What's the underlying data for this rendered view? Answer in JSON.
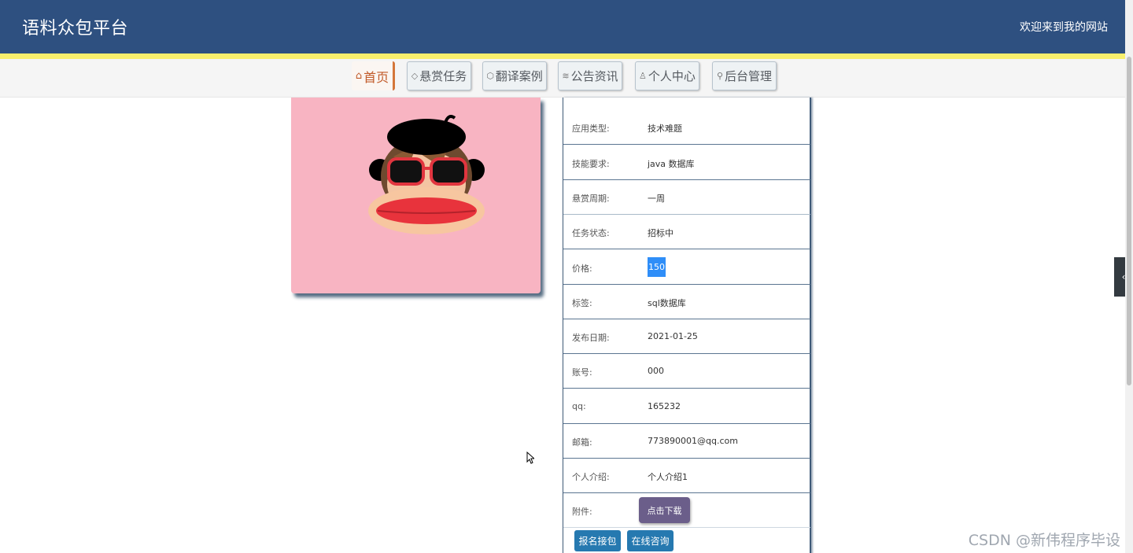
{
  "header": {
    "logo": "语料众包平台",
    "welcome": "欢迎来到我的网站"
  },
  "nav": [
    {
      "label": "首页",
      "icon": "home-icon",
      "glyph": "⌂",
      "active": true
    },
    {
      "label": "悬赏任务",
      "icon": "tag-icon",
      "glyph": "◇",
      "active": false
    },
    {
      "label": "翻译案例",
      "icon": "box-icon",
      "glyph": "⬡",
      "active": false
    },
    {
      "label": "公告资讯",
      "icon": "layers-icon",
      "glyph": "≋",
      "active": false
    },
    {
      "label": "个人中心",
      "icon": "user-icon",
      "glyph": "♙",
      "active": false
    },
    {
      "label": "后台管理",
      "icon": "link-icon",
      "glyph": "⚲",
      "active": false
    }
  ],
  "details": [
    {
      "label": "应用类型:",
      "value": "技术难题"
    },
    {
      "label": "技能要求:",
      "value": "java 数据库"
    },
    {
      "label": "悬赏周期:",
      "value": "一周"
    },
    {
      "label": "任务状态:",
      "value": "招标中"
    },
    {
      "label": "价格:",
      "value": "150"
    },
    {
      "label": "标签:",
      "value": "sql数据库"
    },
    {
      "label": "发布日期:",
      "value": "2021-01-25"
    },
    {
      "label": "账号:",
      "value": "000"
    },
    {
      "label": "qq:",
      "value": "165232"
    },
    {
      "label": "邮箱:",
      "value": "773890001@qq.com"
    },
    {
      "label": "个人介绍:",
      "value": "个人介绍1"
    }
  ],
  "attachment": {
    "label": "附件:",
    "button": "点击下载"
  },
  "actions": {
    "signup": "报名接包",
    "consult": "在线咨询"
  },
  "side_toggle": "‹",
  "watermark": "CSDN @新伟程序毕设",
  "colors": {
    "header": "#2e5080",
    "strip": "#f8ef6d",
    "action_btn": "#2679b0",
    "download_btn": "#6b5e8a",
    "image_bg": "#f8b4c2"
  }
}
